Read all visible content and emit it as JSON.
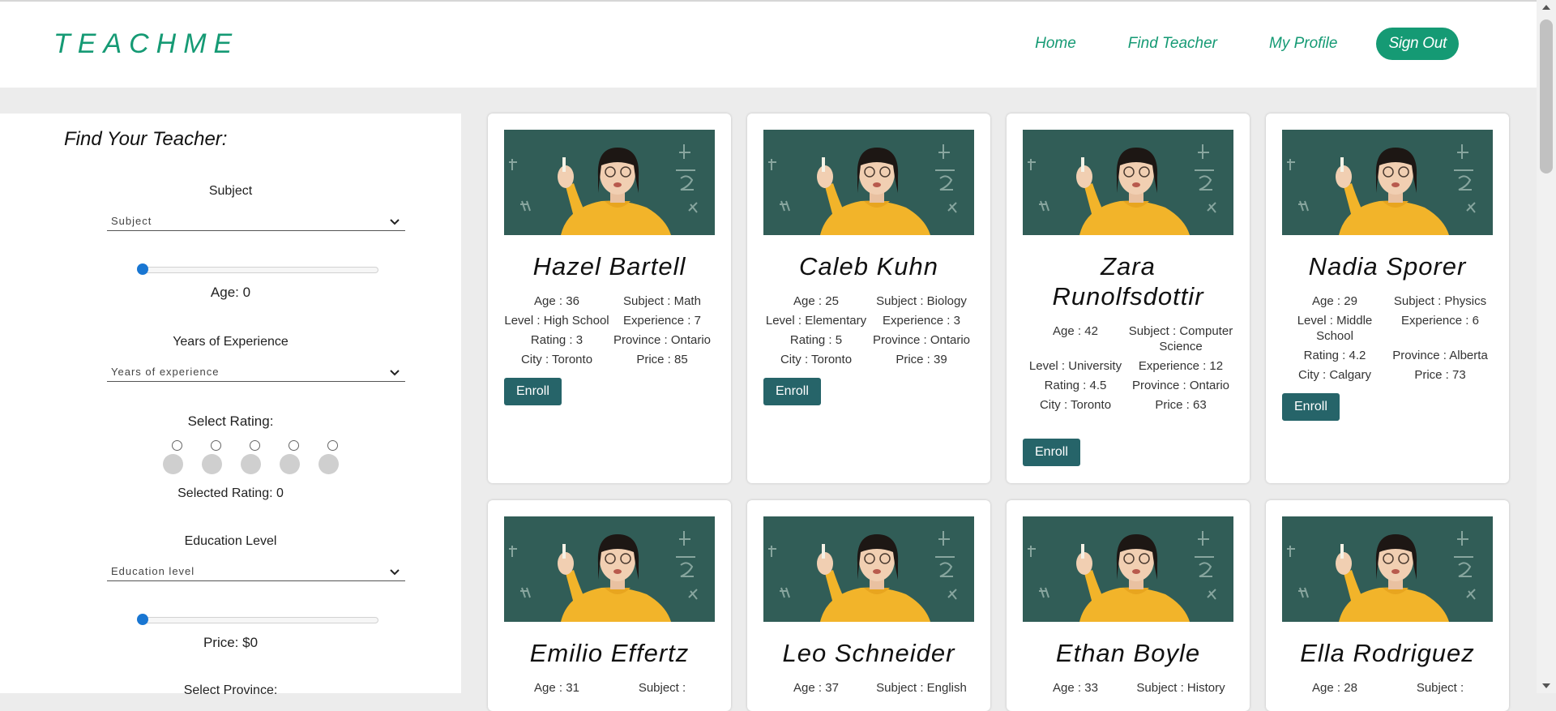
{
  "brand": {
    "logo": "TEACHME",
    "accent": "#159a74",
    "button_color": "#266469"
  },
  "nav": {
    "home": "Home",
    "find_teacher": "Find Teacher",
    "my_profile": "My Profile",
    "sign_out": "Sign Out"
  },
  "sidebar": {
    "title": "Find Your Teacher:",
    "subject_label": "Subject",
    "subject_placeholder": "Subject",
    "age_label": "Age: 0",
    "age_value": 0,
    "experience_label": "Years of Experience",
    "experience_placeholder": "Years of experience",
    "rating_label": "Select Rating:",
    "rating_options": [
      1,
      2,
      3,
      4,
      5
    ],
    "selected_rating": "Selected Rating: 0",
    "education_label": "Education Level",
    "education_placeholder": "Education level",
    "price_label": "Price: $0",
    "price_value": 0,
    "province_label": "Select Province:"
  },
  "cards": [
    {
      "name": "Hazel Bartell",
      "age": "Age : 36",
      "subject": "Subject : Math",
      "level": "Level : High School",
      "experience": "Experience : 7",
      "rating": "Rating : 3",
      "province": "Province : Ontario",
      "city": "City : Toronto",
      "price": "Price : 85",
      "enroll": "Enroll"
    },
    {
      "name": "Caleb Kuhn",
      "age": "Age : 25",
      "subject": "Subject : Biology",
      "level": "Level : Elementary",
      "experience": "Experience : 3",
      "rating": "Rating : 5",
      "province": "Province : Ontario",
      "city": "City : Toronto",
      "price": "Price : 39",
      "enroll": "Enroll"
    },
    {
      "name": "Zara Runolfsdottir",
      "age": "Age : 42",
      "subject": "Subject : Computer Science",
      "level": "Level : University",
      "experience": "Experience : 12",
      "rating": "Rating : 4.5",
      "province": "Province : Ontario",
      "city": "City : Toronto",
      "price": "Price : 63",
      "enroll": "Enroll"
    },
    {
      "name": "Nadia Sporer",
      "age": "Age : 29",
      "subject": "Subject : Physics",
      "level": "Level : Middle School",
      "experience": "Experience : 6",
      "rating": "Rating : 4.2",
      "province": "Province : Alberta",
      "city": "City : Calgary",
      "price": "Price : 73",
      "enroll": "Enroll"
    },
    {
      "name": "Emilio Effertz",
      "age": "Age : 31",
      "subject": "Subject :"
    },
    {
      "name": "Leo Schneider",
      "age": "Age : 37",
      "subject": "Subject : English"
    },
    {
      "name": "Ethan Boyle",
      "age": "Age : 33",
      "subject": "Subject : History"
    },
    {
      "name": "Ella Rodriguez",
      "age": "Age : 28",
      "subject": "Subject :"
    }
  ]
}
